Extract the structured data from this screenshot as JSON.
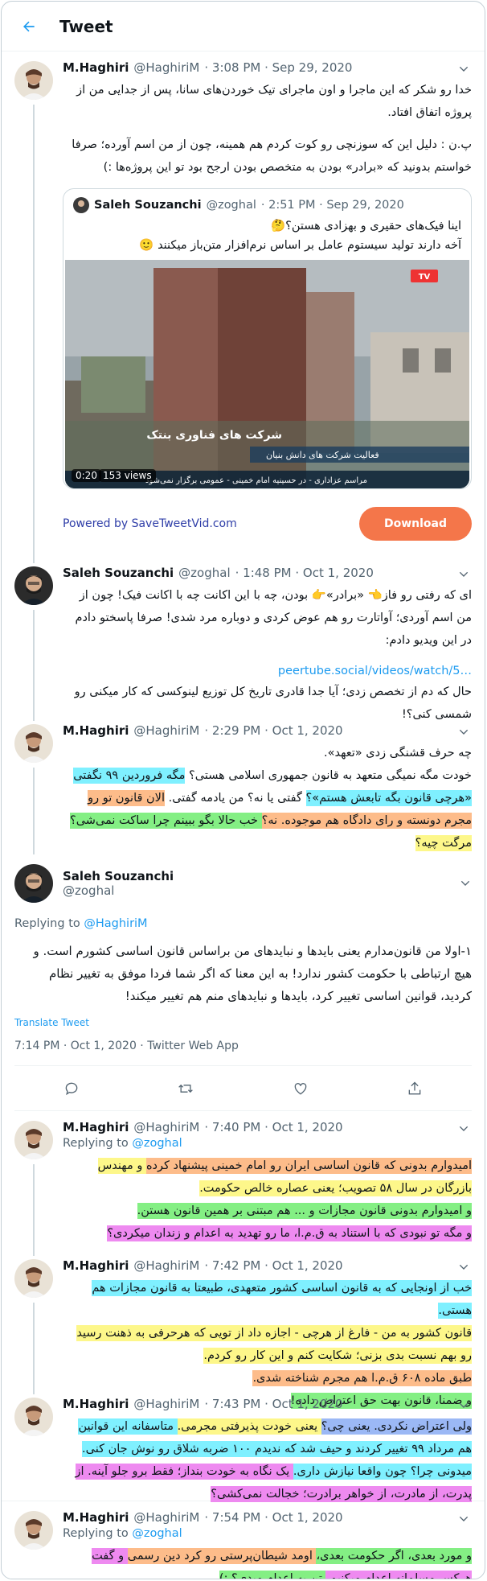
{
  "header": {
    "title": "Tweet"
  },
  "tweets": [
    {
      "name": "M.Haghiri",
      "handle": "@HaghiriM",
      "time": "· 3:08 PM · Sep 29, 2020",
      "p1": "خدا رو شکر که این ماجرا و اون ماجرای تیک خوردن‌های سانا، پس از جدایی من از پروژه اتفاق افتاد.",
      "p2": "پ.ن : دلیل این که سوزنچی رو کوت کردم هم همینه، چون از من اسم آورده؛ صرفا خواستم بدونید که «برادر» بودن به متخصص بودن ارجح بود تو این پروژه‌ها :)",
      "quote": {
        "name": "Saleh Souzanchi",
        "handle": "@zoghal",
        "time": "· 2:51 PM · Sep 29, 2020",
        "l1": "اینا فیک‌های حقیری و بهزادی هستن؟🤔",
        "l2": "آخه دارند تولید سیستوم عامل بر اساس نرم‌افزار متن‌باز میکنند 🙂",
        "duration": "0:20",
        "views": "153 views",
        "caption1": "شرکت های فناوری بنتک",
        "caption2": "فعالیت شرکت های دانش بنیان",
        "ticker": "مراسم عزاداری - در حسینیه امام خمینی - عمومی برگزار نمی‌شود",
        "tv": "TV"
      },
      "powered": "Powered by SaveTweetVid.com",
      "download": "Download"
    },
    {
      "name": "Saleh Souzanchi",
      "handle": "@zoghal",
      "time": "· 1:48 PM · Oct 1, 2020",
      "p1": "ای که رفتی رو فاز👈 «برادر»👉 بودن، چه با این اکانت چه با اکانت فیک! چون از من اسم آوردی؛ آواتارت رو هم عوض کردی و دوباره مرد شدی! صرفا پاسختو دادم در این ویدیو دادم:",
      "link": "peertube.social/videos/watch/5…",
      "p2": "حال که دم از تخصص زدی؛ آیا جدا قادری تاریخ کل توزیع لینوکسی که کار میکنی رو شمسی کنی؟!"
    },
    {
      "name": "M.Haghiri",
      "handle": "@HaghiriM",
      "time": "· 2:29 PM · Oct 1, 2020",
      "s1": "چه حرف قشنگی زدی «تعهد».",
      "s2": "خودت مگه نمیگی متعهد به قانون جمهوری اسلامی هستی؟ ",
      "s3": "مگه فروردین ۹۹ نگفتی",
      "s4": "«هرچی قانون بگه تابعش هستم»؟",
      "s5": " گفتی یا نه؟ من یادمه گفتی.",
      "s6": "الان قانون تو رو مجرم دونسته و رای دادگاه هم موجوده. نه؟",
      "s7": " خب حالا بگو ببینم چرا ساکت نمی‌شی؟",
      "s8": " مرگت چیه؟"
    }
  ],
  "focus": {
    "name": "Saleh Souzanchi",
    "handle": "@zoghal",
    "replying": "Replying to",
    "replying_to": "@HaghiriM",
    "body": "۱-اولا من قانون‌مدارم یعنی بایدها و نبایدهای من براساس قانون اساسی کشورم است. و هیچ ارتباطی با حکومت کشور ندارد! به این معنا که اگر شما فردا موفق به تغییر نظام کردید، قوانین اساسی تغییر کرد، بایدها و نبایدهای منم هم تغییر میکند!",
    "translate": "Translate Tweet",
    "timestamp": "7:14 PM · Oct 1, 2020 · Twitter Web App"
  },
  "replies": [
    {
      "name": "M.Haghiri",
      "handle": "@HaghiriM",
      "time": "· 7:40 PM · Oct 1, 2020",
      "replying": "Replying to",
      "to": "@zoghal",
      "s1": "امیدوارم بدونی که قانون اساسی ایران رو امام خمینی پیشنهاد کرده",
      "s2": " و مهندس بازرگان در سال ۵۸ تصویب؛ یعنی عصاره خالص حکومت.",
      "s3": "و امیدوارم بدونی قانون مجازات و ... هم مبتنی بر همین قانون هستن.",
      "s4": "و مگه تو نبودی که با استناد به ق.م.ا، ما رو تهدید به اعدام و زندان میکردی؟"
    },
    {
      "name": "M.Haghiri",
      "handle": "@HaghiriM",
      "time": "· 7:42 PM · Oct 1, 2020",
      "s1": "خب از اونجایی که به قانون اساسی کشور متعهدی، طبیعتا به قانون مجازات هم هستی.",
      "s2": "قانون کشور به من - فارغ از هرچی - اجازه داد از تویی که هرحرفی به ذهنت رسید رو بهم نسبت بدی بزنی؛",
      "s3": " شکایت کنم و این کار رو کردم.",
      "s4": "طبق ماده ۶۰۸ ق.م.ا هم مجرم شناخته شدی.",
      "s5": "و ضمنا، قانون بهت حق اعتراض داده!"
    },
    {
      "name": "M.Haghiri",
      "handle": "@HaghiriM",
      "time": "· 7:43 PM · Oct 1, 2020",
      "s1": "ولی اعتراض نکردی. یعنی چی؟",
      "s2": " یعنی خودت پذیرفتی مجرمی.",
      "s3": " متاسفانه این قوانین هم مرداد ۹۹ تغییر کردند و حیف شد که ندیدم ۱۰۰ ضربه شلاق رو نوش جان کنی.",
      "s4": "میدونی چرا؟ چون واقعا نیازش داری.",
      "s5": " یک نگاه به خودت بنداز؛ فقط برو جلو آینه. از پدرت، از مادرت، از خواهر برادرت؛ خجالت نمی‌کشی؟"
    },
    {
      "name": "M.Haghiri",
      "handle": "@HaghiriM",
      "time": "· 7:54 PM · Oct 1, 2020",
      "replying": "Replying to",
      "to": "@zoghal",
      "s1": "و مورد بعدی، اگر حکومت بعدی،",
      "s2": " اومد شیطان‌پرستی رو کرد دین رسمی",
      "s3": " و گفت هرکس مسلمانه اعدام میکنیم،",
      "s4": " تن به اعدام میدی؟ :)"
    }
  ],
  "colors": {
    "accent": "#1d9bf0",
    "download": "#f4764a",
    "powered": "#2f3ea8"
  }
}
